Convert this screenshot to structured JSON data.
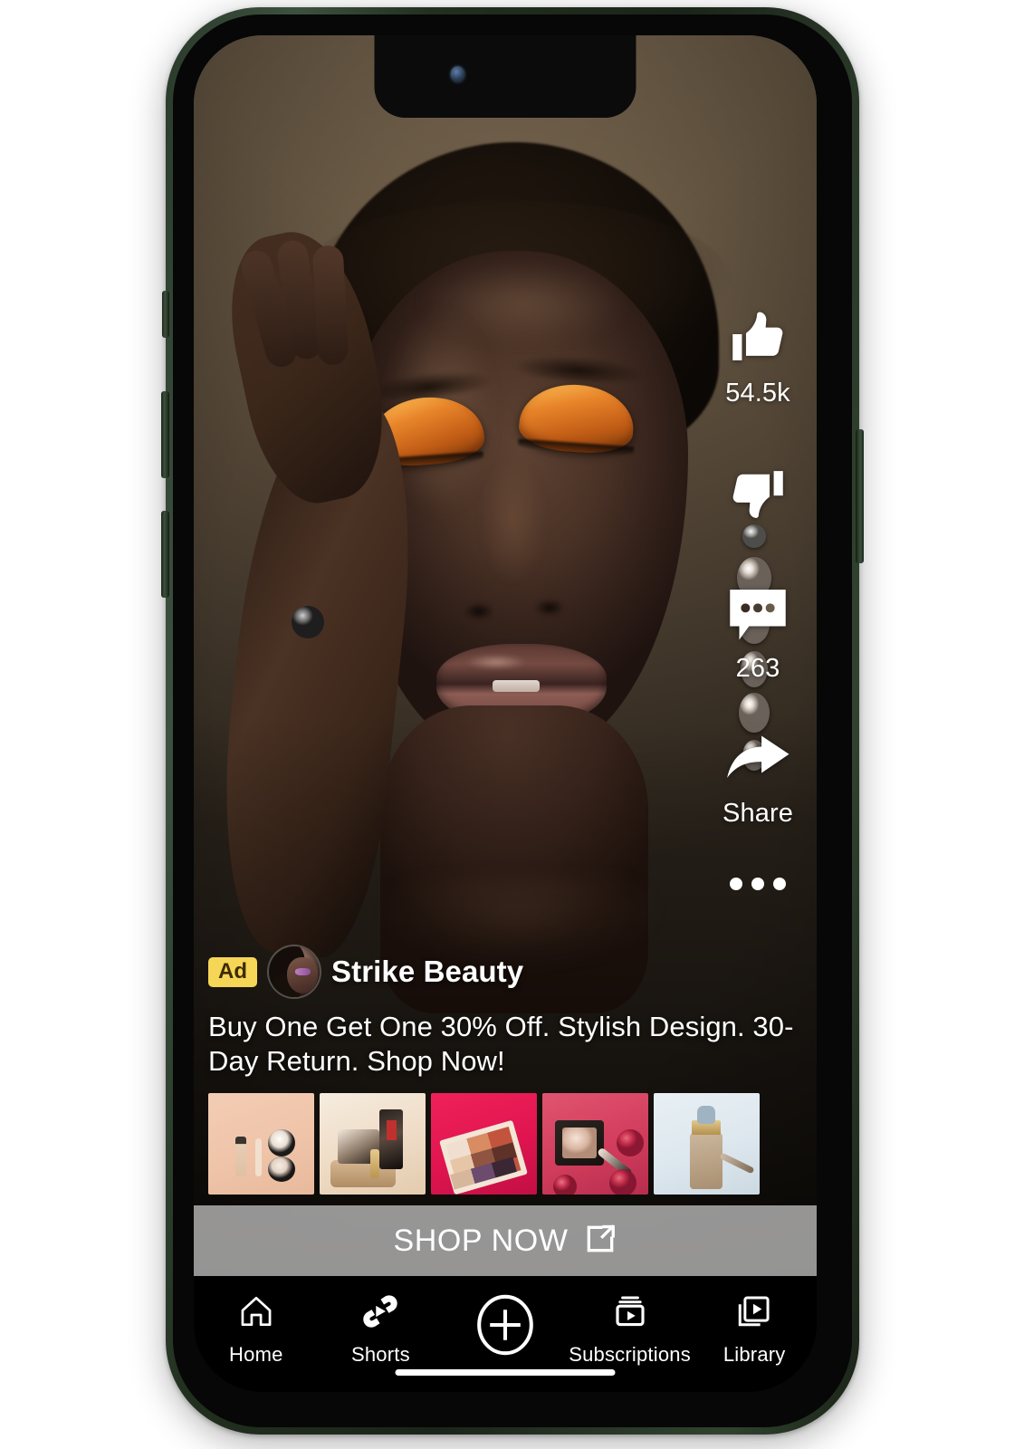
{
  "device": {
    "frame_color": "#2f4330",
    "notch": {
      "camera_icon": "front-camera-dot",
      "speaker_icon": "earpiece-speaker"
    },
    "buttons": [
      "mute-switch",
      "volume-up",
      "volume-down",
      "power"
    ]
  },
  "video": {
    "background_color": "#6b5b46",
    "subject_description": "close-up portrait of a model wearing orange gold eyeshadow and pearl drop earrings"
  },
  "action_rail": [
    {
      "id": "like",
      "icon": "thumbs-up-icon",
      "count": "54.5k"
    },
    {
      "id": "dislike",
      "icon": "thumbs-down-icon",
      "count": ""
    },
    {
      "id": "comment",
      "icon": "comment-bubble-icon",
      "count": "263"
    },
    {
      "id": "share",
      "icon": "share-arrow-icon",
      "count": "Share"
    },
    {
      "id": "more",
      "icon": "more-horizontal-icon",
      "count": ""
    }
  ],
  "ad": {
    "badge": "Ad",
    "advertiser": "Strike Beauty",
    "avatar_icon": "advertiser-avatar",
    "description": "Buy One Get One 30% Off. Stylish Design. 30-Day Return. Shop Now!",
    "badge_bg": "#F6D656",
    "badge_fg": "#3d2b00",
    "cta": {
      "label": "SHOP NOW",
      "icon": "external-link-icon"
    },
    "thumbnails": [
      {
        "id": "thumb-1",
        "alt": "foundation bottle, brush and powder compacts on peach background"
      },
      {
        "id": "thumb-2",
        "alt": "compact powder and lipstick on wooden riser"
      },
      {
        "id": "thumb-3",
        "alt": "eyeshadow palette on red background"
      },
      {
        "id": "thumb-4",
        "alt": "blush compact and lip pencil on pink background"
      },
      {
        "id": "thumb-5",
        "alt": "liquid foundation bottle on light blue background"
      }
    ]
  },
  "tabbar": {
    "items": [
      {
        "id": "home",
        "label": "Home",
        "icon": "home-icon"
      },
      {
        "id": "shorts",
        "label": "Shorts",
        "icon": "shorts-icon"
      },
      {
        "id": "create",
        "label": "",
        "icon": "plus-circle-icon"
      },
      {
        "id": "subscriptions",
        "label": "Subscriptions",
        "icon": "subscriptions-icon"
      },
      {
        "id": "library",
        "label": "Library",
        "icon": "library-icon"
      }
    ]
  }
}
